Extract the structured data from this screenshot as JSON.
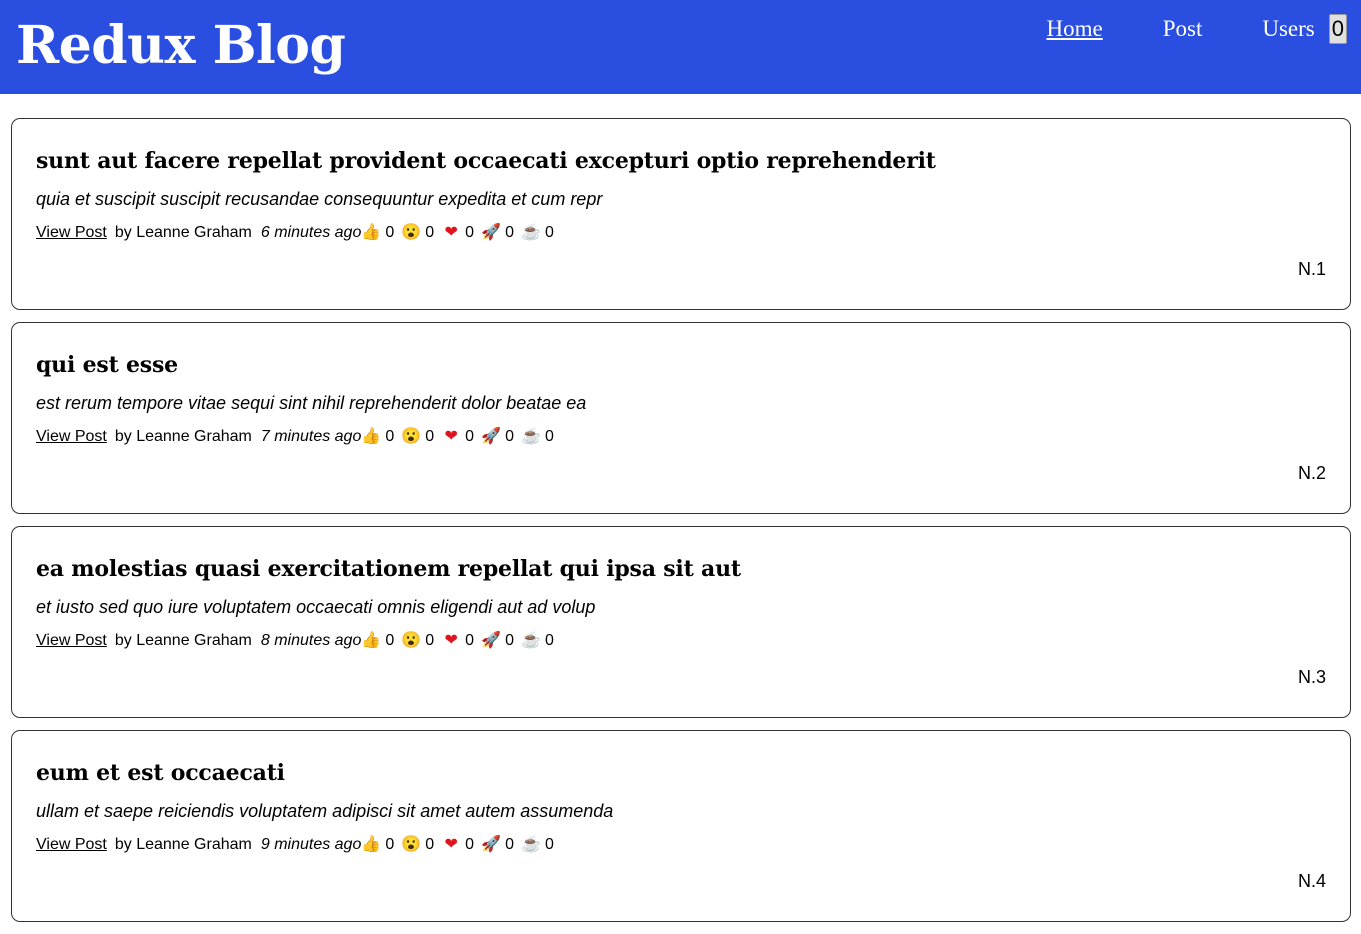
{
  "header": {
    "brand": "Redux Blog",
    "nav": {
      "home": "Home",
      "post": "Post",
      "users": "Users",
      "count": "0"
    }
  },
  "posts": [
    {
      "title": "sunt aut facere repellat provident occaecati excepturi optio reprehenderit",
      "excerpt": "quia et suscipit suscipit recusandae consequuntur expedita et cum repr",
      "link": "View Post",
      "author": "by Leanne Graham",
      "time": "6 minutes ago",
      "reactions": {
        "thumbs": "0",
        "wow": "0",
        "heart": "0",
        "rocket": "0",
        "coffee": "0"
      },
      "number": "N.1"
    },
    {
      "title": "qui est esse",
      "excerpt": "est rerum tempore vitae sequi sint nihil reprehenderit dolor beatae ea",
      "link": "View Post",
      "author": "by Leanne Graham",
      "time": "7 minutes ago",
      "reactions": {
        "thumbs": "0",
        "wow": "0",
        "heart": "0",
        "rocket": "0",
        "coffee": "0"
      },
      "number": "N.2"
    },
    {
      "title": "ea molestias quasi exercitationem repellat qui ipsa sit aut",
      "excerpt": "et iusto sed quo iure voluptatem occaecati omnis eligendi aut ad volup",
      "link": "View Post",
      "author": "by Leanne Graham",
      "time": "8 minutes ago",
      "reactions": {
        "thumbs": "0",
        "wow": "0",
        "heart": "0",
        "rocket": "0",
        "coffee": "0"
      },
      "number": "N.3"
    },
    {
      "title": "eum et est occaecati",
      "excerpt": "ullam et saepe reiciendis voluptatem adipisci sit amet autem assumenda",
      "link": "View Post",
      "author": "by Leanne Graham",
      "time": "9 minutes ago",
      "reactions": {
        "thumbs": "0",
        "wow": "0",
        "heart": "0",
        "rocket": "0",
        "coffee": "0"
      },
      "number": "N.4"
    }
  ],
  "reaction_icons": {
    "thumbs": "👍",
    "wow": "😮",
    "heart": "❤",
    "rocket": "🚀",
    "coffee": "☕"
  }
}
